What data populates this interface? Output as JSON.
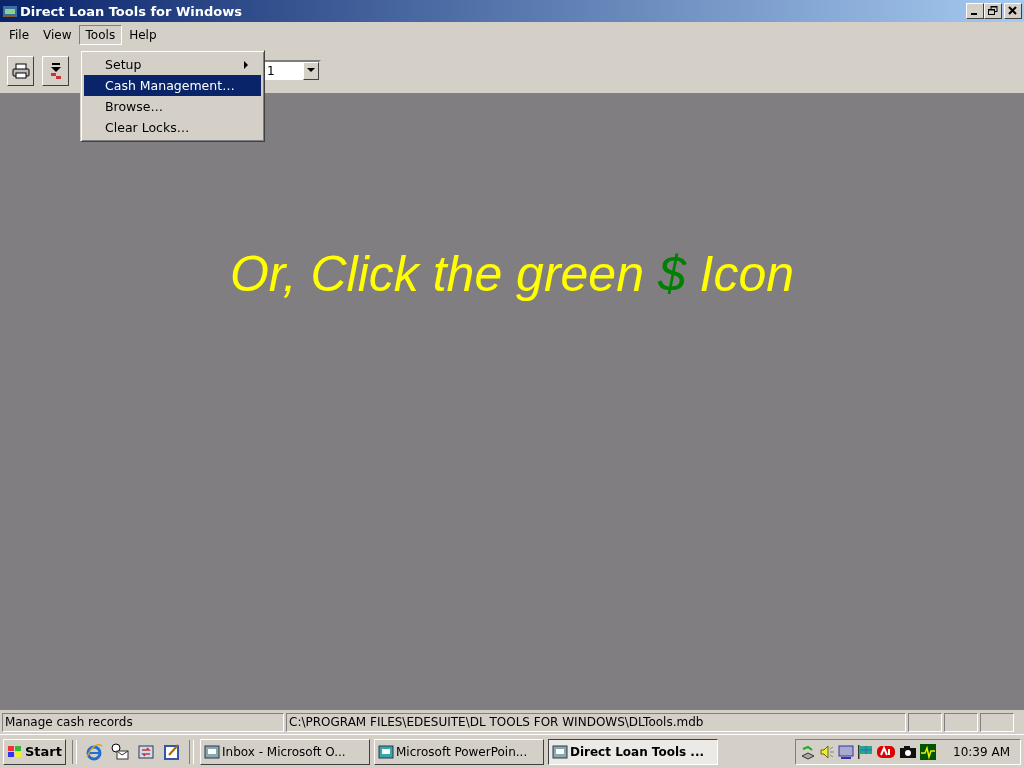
{
  "window": {
    "title": "Direct Loan Tools for Windows"
  },
  "menu_bar": [
    {
      "label": "File",
      "selected": false
    },
    {
      "label": "View",
      "selected": false
    },
    {
      "label": "Tools",
      "selected": true
    },
    {
      "label": "Help",
      "selected": false
    }
  ],
  "tools_menu": [
    {
      "label": "Setup",
      "submenu": true,
      "selected": false
    },
    {
      "label": "Cash Management…",
      "submenu": false,
      "selected": true
    },
    {
      "label": "Browse…",
      "submenu": false,
      "selected": false
    },
    {
      "label": "Clear Locks…",
      "submenu": false,
      "selected": false
    }
  ],
  "toolbar": {
    "combo_value": "1"
  },
  "overlay": {
    "segments": [
      {
        "text": "Or, Click the green ",
        "color": "#ffff00"
      },
      {
        "text": "$",
        "color": "#008000"
      },
      {
        "text": " Icon",
        "color": "#ffff00"
      }
    ]
  },
  "status_bar": [
    "Manage cash records",
    "C:\\PROGRAM FILES\\EDESUITE\\DL TOOLS FOR WINDOWS\\DLTools.mdb"
  ],
  "taskbar": {
    "start": "Start",
    "tasks": [
      {
        "label": "Inbox - Microsoft O...",
        "selected": false
      },
      {
        "label": "Microsoft PowerPoin...",
        "selected": false
      },
      {
        "label": "Direct Loan Tools ...",
        "selected": true
      }
    ],
    "clock": "10:39 AM"
  }
}
